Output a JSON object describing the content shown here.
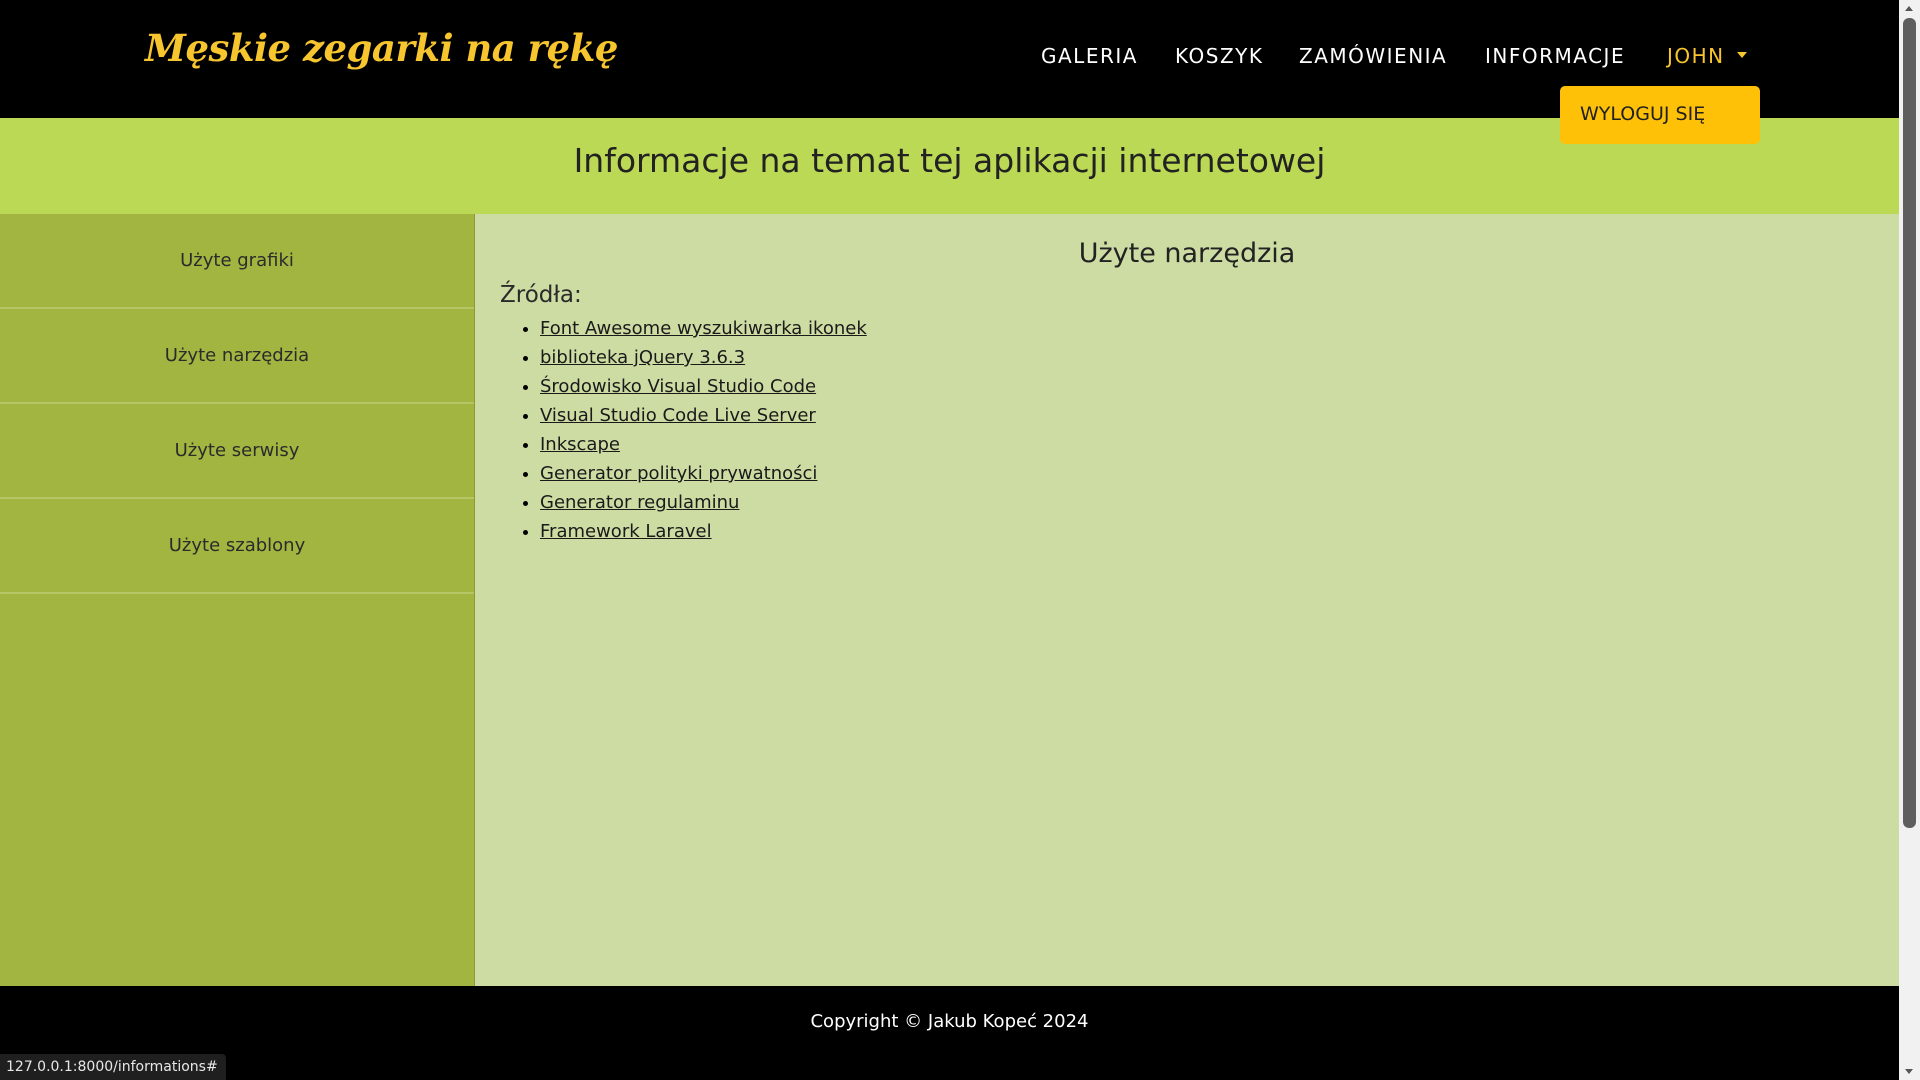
{
  "navbar": {
    "brand": "Męskie zegarki na rękę",
    "links": [
      "GALERIA",
      "KOSZYK",
      "ZAMÓWIENIA",
      "INFORMACJE"
    ],
    "user": "JOHN",
    "dropdown_item": "WYLOGUJ SIĘ"
  },
  "page": {
    "heading": "Informacje na temat tej aplikacji internetowej"
  },
  "sidebar": {
    "items": [
      "Użyte grafiki",
      "Użyte narzędzia",
      "Użyte serwisy",
      "Użyte szablony"
    ]
  },
  "content": {
    "title": "Użyte narzędzia",
    "sources_label": "Źródła:",
    "links": [
      "Font Awesome wyszukiwarka ikonek",
      "biblioteka jQuery 3.6.3",
      "Środowisko Visual Studio Code",
      "Visual Studio Code Live Server",
      "Inkscape",
      "Generator polityki prywatności",
      "Generator regulaminu",
      "Framework Laravel"
    ]
  },
  "footer": {
    "copyright": "Copyright © Jakub Kopeć 2024"
  },
  "status_bar": {
    "url": "127.0.0.1:8000/informations#"
  },
  "colors": {
    "brand": "#f7c52e",
    "heading_band": "#bcd956",
    "sidebar": "#a2b540",
    "content": "#cddca3",
    "dropdown": "#ffc107"
  }
}
